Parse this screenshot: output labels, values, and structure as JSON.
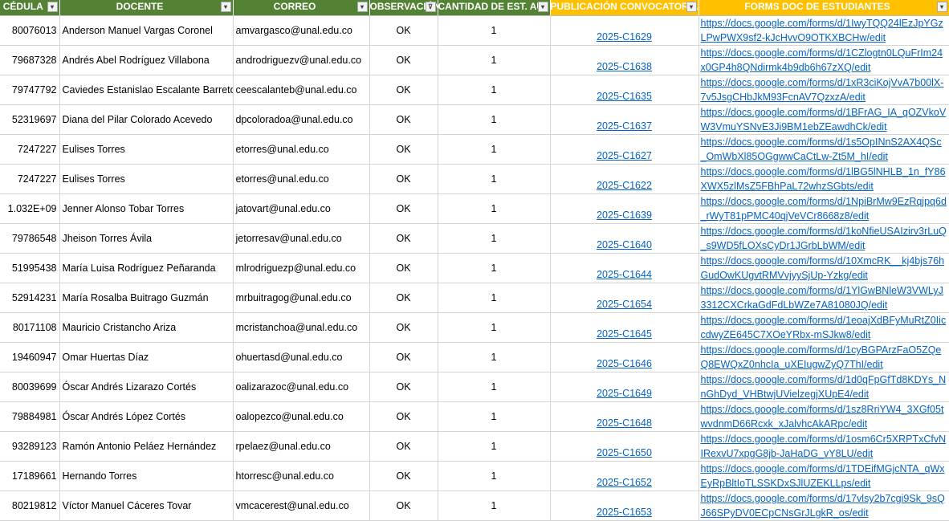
{
  "headers": [
    {
      "label": "CÉDULA",
      "filter": "▾"
    },
    {
      "label": "DOCENTE",
      "filter": "▾"
    },
    {
      "label": "CORREO",
      "filter": "▾"
    },
    {
      "label": "OBSERVACIÓN",
      "filter": "⊽"
    },
    {
      "label": "CANTIDAD DE EST. AU",
      "filter": "▾"
    },
    {
      "label": "PUBLICACIÓN CONVOCATORIA",
      "filter": "▾"
    },
    {
      "label": "FORMS DOC DE ESTUDIANTES",
      "filter": "▾"
    }
  ],
  "rows": [
    {
      "cedula": "80076013",
      "docente": "Anderson Manuel Vargas Coronel",
      "correo": "amvargasco@unal.edu.co",
      "obs": "OK",
      "cant": "1",
      "pub": "2025-C1629",
      "form": "https://docs.google.com/forms/d/1IwyTQQ24lEzJpYGzLPwPWX9sf2-kJcHvvO9OTKXBCHw/edit"
    },
    {
      "cedula": "79687328",
      "docente": "Andrés Abel Rodríguez Villabona",
      "correo": "androdriguezv@unal.edu.co",
      "obs": "OK",
      "cant": "1",
      "pub": "2025-C1638",
      "form": "https://docs.google.com/forms/d/1CZlogtn0LQuFrIm24x0GP4h8QNdirmk4b9db6h67zXQ/edit"
    },
    {
      "cedula": "79747792",
      "docente": "Caviedes Estanislao Escalante Barreto",
      "correo": "ceescalanteb@unal.edu.co",
      "obs": "OK",
      "cant": "1",
      "pub": "2025-C1635",
      "form": "https://docs.google.com/forms/d/1xR3ciKojVvA7b00lX-7v5JsgCHbJkM93FcnAV7QzxzA/edit"
    },
    {
      "cedula": "52319697",
      "docente": "Diana del Pilar Colorado Acevedo",
      "correo": "dpcoloradoa@unal.edu.co",
      "obs": "OK",
      "cant": "1",
      "pub": "2025-C1637",
      "form": "https://docs.google.com/forms/d/1BFrAG_IA_qOZVkoVW3VmuYSNvE3Ji9BM1ebZEawdhCk/edit"
    },
    {
      "cedula": "7247227",
      "docente": "Eulises Torres",
      "correo": "etorres@unal.edu.co",
      "obs": "OK",
      "cant": "1",
      "pub": "2025-C1627",
      "form": "https://docs.google.com/forms/d/1s5OpINnS2AX4QSc_OmWbXl85OGgwwCaCtLw-Zt5M_hI/edit"
    },
    {
      "cedula": "7247227",
      "docente": "Eulises Torres",
      "correo": "etorres@unal.edu.co",
      "obs": "OK",
      "cant": "1",
      "pub": "2025-C1622",
      "form": "https://docs.google.com/forms/d/1lBG5lNHLB_1n_fY86XWX5zlMsZ5FBhPaL72whzSGbts/edit"
    },
    {
      "cedula": "1.032E+09",
      "docente": "Jenner Alonso Tobar Torres",
      "correo": "jatovart@unal.edu.co",
      "obs": "OK",
      "cant": "1",
      "pub": "2025-C1639",
      "form": "https://docs.google.com/forms/d/1NpiBrMw9EzRqjpq6d_rWyT81pPMC40qjVeVCr8668z8/edit"
    },
    {
      "cedula": "79786548",
      "docente": "Jheison Torres Ávila",
      "correo": "jetorresav@unal.edu.co",
      "obs": "OK",
      "cant": "1",
      "pub": "2025-C1640",
      "form": "https://docs.google.com/forms/d/1koNfieUSAIzirv3rLuQ_s9WD5fLOXsCyDr1JGrbLbWM/edit"
    },
    {
      "cedula": "51995438",
      "docente": "María Luisa Rodríguez Peñaranda",
      "correo": "mlrodriguezp@unal.edu.co",
      "obs": "OK",
      "cant": "1",
      "pub": "2025-C1644",
      "form": "https://docs.google.com/forms/d/10XmcRK__kj4bjs76hGudOwKUgvtRMVvjyySjUp-Yzkg/edit"
    },
    {
      "cedula": "52914231",
      "docente": "María Rosalba Buitrago Guzmán",
      "correo": "mrbuitragog@unal.edu.co",
      "obs": "OK",
      "cant": "1",
      "pub": "2025-C1654",
      "form": "https://docs.google.com/forms/d/1YlGwBNleW3VWLyJ3312CXCrkaGdFdLbWZe7A81080JQ/edit"
    },
    {
      "cedula": "80171108",
      "docente": "Mauricio Cristancho Ariza",
      "correo": "mcristanchoa@unal.edu.co",
      "obs": "OK",
      "cant": "1",
      "pub": "2025-C1645",
      "form": "https://docs.google.com/forms/d/1eoajXdBFyMuRtZ0IiccdwyZE645C7XOeYRbx-mSJkw8/edit"
    },
    {
      "cedula": "19460947",
      "docente": "Omar Huertas Díaz",
      "correo": "ohuertasd@unal.edu.co",
      "obs": "OK",
      "cant": "1",
      "pub": "2025-C1646",
      "form": "https://docs.google.com/forms/d/1cyBGPArzFaO5ZQeQ8EWQxZ0nhcIa_uXEIugwZyQ7ThI/edit"
    },
    {
      "cedula": "80039699",
      "docente": "Óscar Andrés Lizarazo Cortés",
      "correo": "oalizarazoc@unal.edu.co",
      "obs": "OK",
      "cant": "1",
      "pub": "2025-C1649",
      "form": "https://docs.google.com/forms/d/1d0qFpGfTd8KDYs_NnGhDyd_VHBtwjUVielzegjXUpE4/edit"
    },
    {
      "cedula": "79884981",
      "docente": "Óscar Andrés López Cortés",
      "correo": "oalopezco@unal.edu.co",
      "obs": "OK",
      "cant": "1",
      "pub": "2025-C1648",
      "form": "https://docs.google.com/forms/d/1sz8RriYW4_3XGf05twvdnmD66Rcxk_xJalvhcAkARpc/edit"
    },
    {
      "cedula": "93289123",
      "docente": "Ramón Antonio Peláez Hernández",
      "correo": "rpelaez@unal.edu.co",
      "obs": "OK",
      "cant": "1",
      "pub": "2025-C1650",
      "form": "https://docs.google.com/forms/d/1osm6Cr5XRPTxCfvNIRexvU7xpgG8jb-JaHaDG_vY8LU/edit"
    },
    {
      "cedula": "17189661",
      "docente": "Hernando Torres",
      "correo": "htorresc@unal.edu.co",
      "obs": "OK",
      "cant": "1",
      "pub": "2025-C1652",
      "form": "https://docs.google.com/forms/d/1TDEifMGjcNTA_qWxEyRpBltIoTLSSKDxSJlUZEKLLps/edit"
    },
    {
      "cedula": "80219812",
      "docente": "Víctor Manuel Cáceres Tovar",
      "correo": "vmcacerest@unal.edu.co",
      "obs": "OK",
      "cant": "1",
      "pub": "2025-C1653",
      "form": "https://docs.google.com/forms/d/17vlsy2b7cgi9Sk_9sQJ66SPyDV0ECpCNsGrJLgkR_os/edit"
    }
  ],
  "colors": {
    "header_green": "#548235",
    "header_gold": "#ffc000",
    "link": "#0563c1"
  }
}
